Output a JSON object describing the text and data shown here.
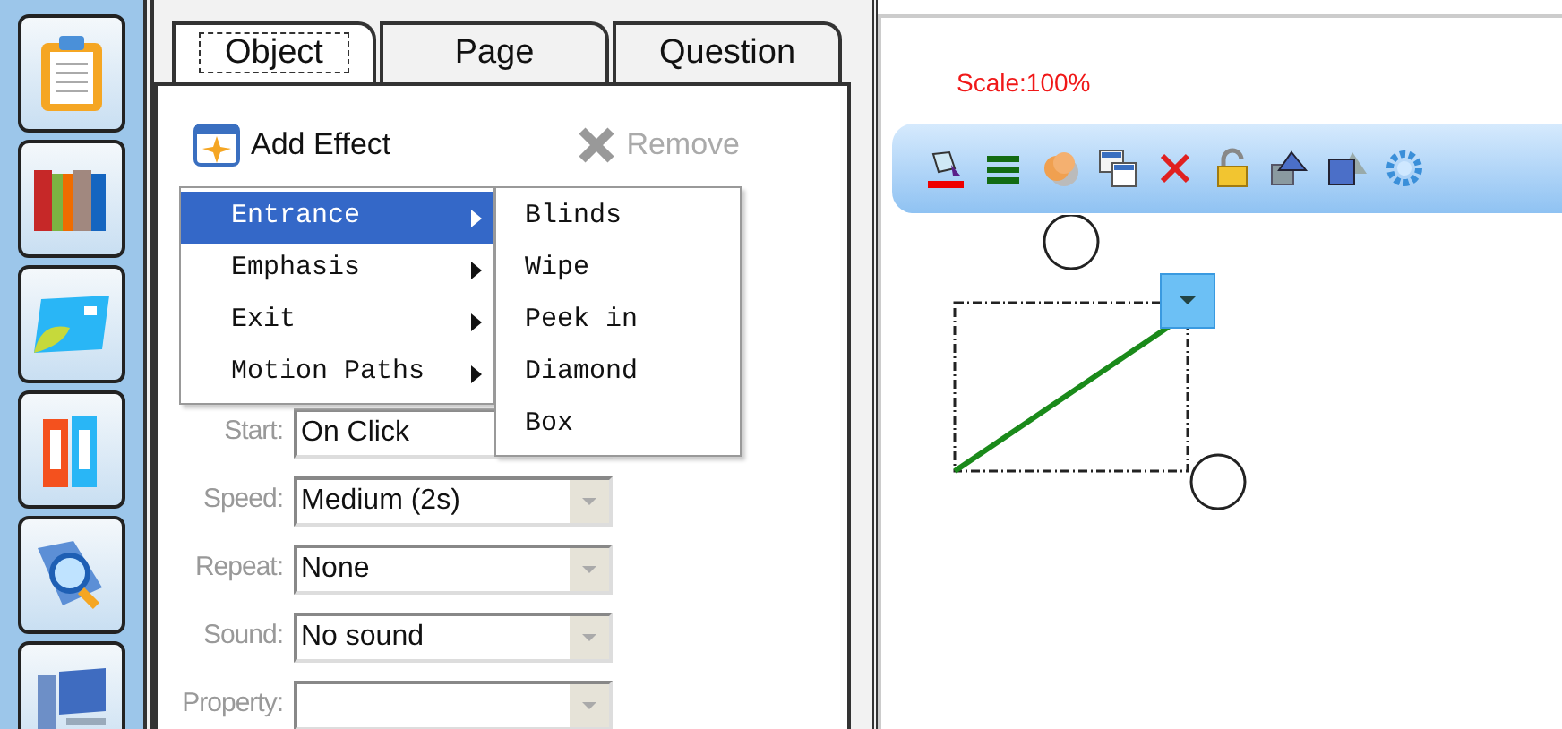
{
  "sidebar": {
    "items": [
      {
        "kind": "clipboard"
      },
      {
        "kind": "books"
      },
      {
        "kind": "card"
      },
      {
        "kind": "binders"
      },
      {
        "kind": "search"
      },
      {
        "kind": "computer"
      }
    ]
  },
  "tabs": [
    {
      "label": "Object",
      "selected": true
    },
    {
      "label": "Page",
      "selected": false
    },
    {
      "label": "Question",
      "selected": false
    }
  ],
  "actions": [
    {
      "label": "Add Effect",
      "kind": "add",
      "disabled": false
    },
    {
      "label": "Remove",
      "kind": "remove",
      "disabled": true
    }
  ],
  "effect_menu": {
    "items": [
      {
        "label": "Entrance",
        "selected": true
      },
      {
        "label": "Emphasis",
        "selected": false
      },
      {
        "label": "Exit",
        "selected": false
      },
      {
        "label": "Motion Paths",
        "selected": false
      }
    ],
    "submenu": [
      {
        "label": "Blinds"
      },
      {
        "label": "Wipe"
      },
      {
        "label": "Peek in"
      },
      {
        "label": "Diamond"
      },
      {
        "label": "Box"
      }
    ]
  },
  "fields": [
    {
      "label": "Start:",
      "value": "On Click",
      "disabled": true
    },
    {
      "label": "Speed:",
      "value": "Medium (2s)",
      "disabled": true
    },
    {
      "label": "Repeat:",
      "value": "None",
      "disabled": true
    },
    {
      "label": "Sound:",
      "value": "No sound",
      "disabled": true
    },
    {
      "label": "Property:",
      "disabled": true
    }
  ],
  "canvas": {
    "scale": "Scale:100%",
    "toolbar": [
      {
        "kind": "fill"
      },
      {
        "kind": "lines"
      },
      {
        "kind": "circles"
      },
      {
        "kind": "copy"
      },
      {
        "kind": "delete"
      },
      {
        "kind": "lock"
      },
      {
        "kind": "front"
      },
      {
        "kind": "back"
      },
      {
        "kind": "gear"
      }
    ]
  }
}
